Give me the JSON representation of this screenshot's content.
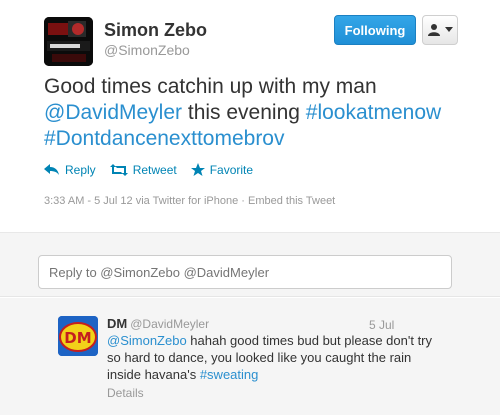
{
  "tweet": {
    "author_name": "Simon Zebo",
    "author_handle": "@SimonZebo",
    "follow_label": "Following",
    "text_plain_1": "Good times catchin up with my man",
    "mention": "@DavidMeyler",
    "text_plain_2": " this evening ",
    "hashtag_1": "#lookatmenow",
    "hashtag_2": "#Dontdancenexttomebrov",
    "actions": {
      "reply": "Reply",
      "retweet": "Retweet",
      "favorite": "Favorite"
    },
    "meta": "3:33 AM - 5 Jul 12 via Twitter for iPhone · Embed this Tweet"
  },
  "reply_box": {
    "placeholder": "Reply to @SimonZebo @DavidMeyler"
  },
  "reply": {
    "author_name": "DM",
    "author_handle": "@DavidMeyler",
    "date": "5 Jul",
    "mention": "@SimonZebo",
    "text": " hahah good times bud but please don't try so hard to dance, you looked like you caught the rain inside havana's ",
    "hashtag": "#sweating",
    "details_label": "Details"
  },
  "colors": {
    "link": "#2a8fcf",
    "action": "#0084b4",
    "follow_button": "#2b9be0",
    "muted": "#999999"
  },
  "icons": [
    "reply-icon",
    "retweet-icon",
    "favorite-star-icon",
    "user-icon",
    "caret-down-icon"
  ]
}
